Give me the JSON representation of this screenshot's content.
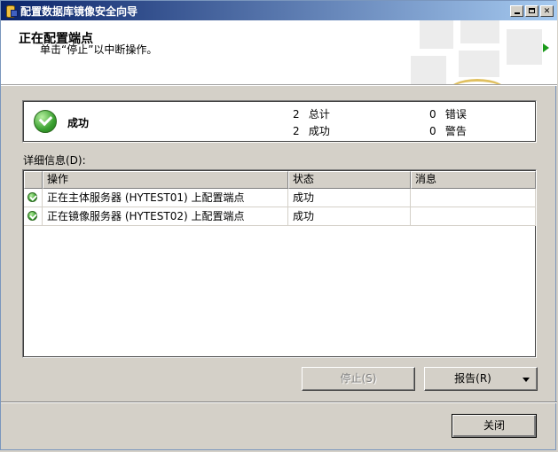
{
  "window": {
    "title": "配置数据库镜像安全向导"
  },
  "header": {
    "title": "正在配置端点",
    "subtitle": "单击“停止”以中断操作。"
  },
  "summary": {
    "status": "成功",
    "stats": [
      {
        "count": "2",
        "label": "总计"
      },
      {
        "count": "0",
        "label": "错误"
      },
      {
        "count": "2",
        "label": "成功"
      },
      {
        "count": "0",
        "label": "警告"
      }
    ]
  },
  "details": {
    "label": "详细信息(D):",
    "columns": [
      "操作",
      "状态",
      "消息"
    ],
    "rows": [
      {
        "action": "正在主体服务器 (HYTEST01) 上配置端点",
        "status": "成功",
        "message": ""
      },
      {
        "action": "正在镜像服务器 (HYTEST02) 上配置端点",
        "status": "成功",
        "message": ""
      }
    ]
  },
  "buttons": {
    "stop": "停止(S)",
    "report": "报告(R)",
    "close": "关闭"
  },
  "colors": {
    "success_green": "#3aa030",
    "title_bar": "#0a246a",
    "window_face": "#d4d0c8"
  }
}
